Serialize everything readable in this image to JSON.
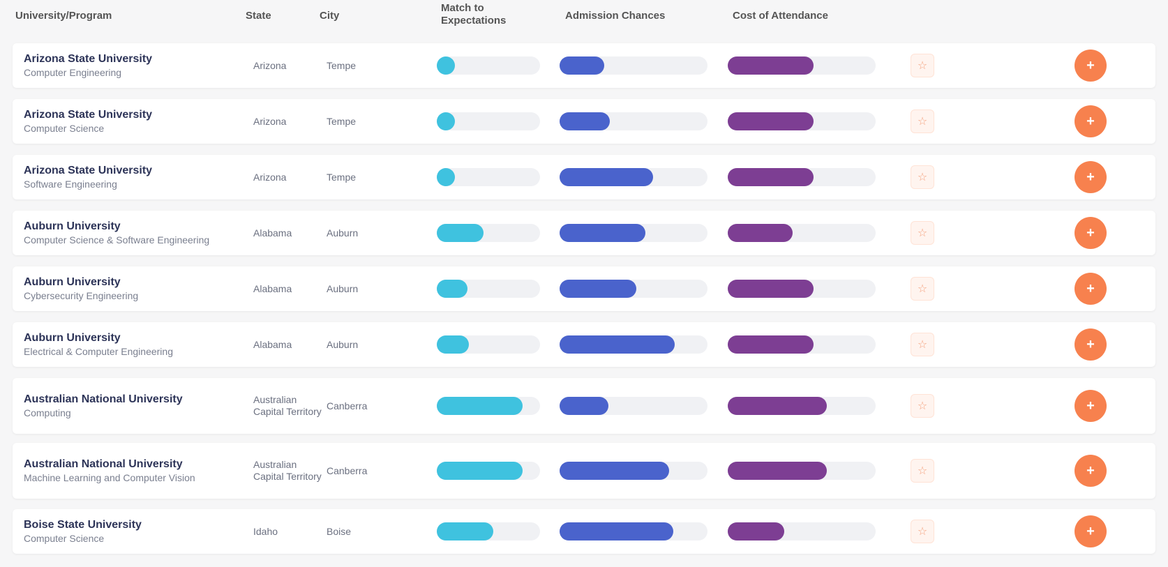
{
  "header": {
    "col_program": "University/Program",
    "col_state": "State",
    "col_city": "City",
    "col_match": "Match to Expectations",
    "col_admission": "Admission Chances",
    "col_cost": "Cost of Attendance"
  },
  "colors": {
    "match": "#3fc2df",
    "admission": "#4a63cc",
    "cost": "#7d3e93",
    "action": "#f7814e"
  },
  "icons": {
    "save": "bookmark-icon",
    "action": "plus-icon"
  },
  "rows": [
    {
      "university": "Arizona State University",
      "program": "Computer Engineering",
      "state": "Arizona",
      "city": "Tempe",
      "match": 10,
      "match_label": "",
      "admission": 30,
      "admission_label": "",
      "cost": 58,
      "cost_label": ""
    },
    {
      "university": "Arizona State University",
      "program": "Computer Science",
      "state": "Arizona",
      "city": "Tempe",
      "match": 10,
      "match_label": "",
      "admission": 34,
      "admission_label": "",
      "cost": 58,
      "cost_label": ""
    },
    {
      "university": "Arizona State University",
      "program": "Software Engineering",
      "state": "Arizona",
      "city": "Tempe",
      "match": 10,
      "match_label": "",
      "admission": 63,
      "admission_label": "",
      "cost": 58,
      "cost_label": ""
    },
    {
      "university": "Auburn University",
      "program": "Computer Science & Software Engineering",
      "state": "Alabama",
      "city": "Auburn",
      "match": 45,
      "match_label": "",
      "admission": 58,
      "admission_label": "",
      "cost": 44,
      "cost_label": ""
    },
    {
      "university": "Auburn University",
      "program": "Cybersecurity Engineering",
      "state": "Alabama",
      "city": "Auburn",
      "match": 30,
      "match_label": "",
      "admission": 52,
      "admission_label": "",
      "cost": 58,
      "cost_label": ""
    },
    {
      "university": "Auburn University",
      "program": "Electrical & Computer Engineering",
      "state": "Alabama",
      "city": "Auburn",
      "match": 31,
      "match_label": "",
      "admission": 78,
      "admission_label": "",
      "cost": 58,
      "cost_label": ""
    },
    {
      "university": "Australian National University",
      "program": "Computing",
      "state": "Australian Capital Territory",
      "city": "Canberra",
      "match": 83,
      "match_label": "",
      "admission": 33,
      "admission_label": "",
      "cost": 67,
      "cost_label": ""
    },
    {
      "university": "Australian National University",
      "program": "Machine Learning and Computer Vision",
      "state": "Australian Capital Territory",
      "city": "Canberra",
      "match": 83,
      "match_label": "",
      "admission": 74,
      "admission_label": "",
      "cost": 67,
      "cost_label": ""
    },
    {
      "university": "Boise State University",
      "program": "Computer Science",
      "state": "Idaho",
      "city": "Boise",
      "match": 55,
      "match_label": "",
      "admission": 77,
      "admission_label": "",
      "cost": 38,
      "cost_label": ""
    }
  ]
}
